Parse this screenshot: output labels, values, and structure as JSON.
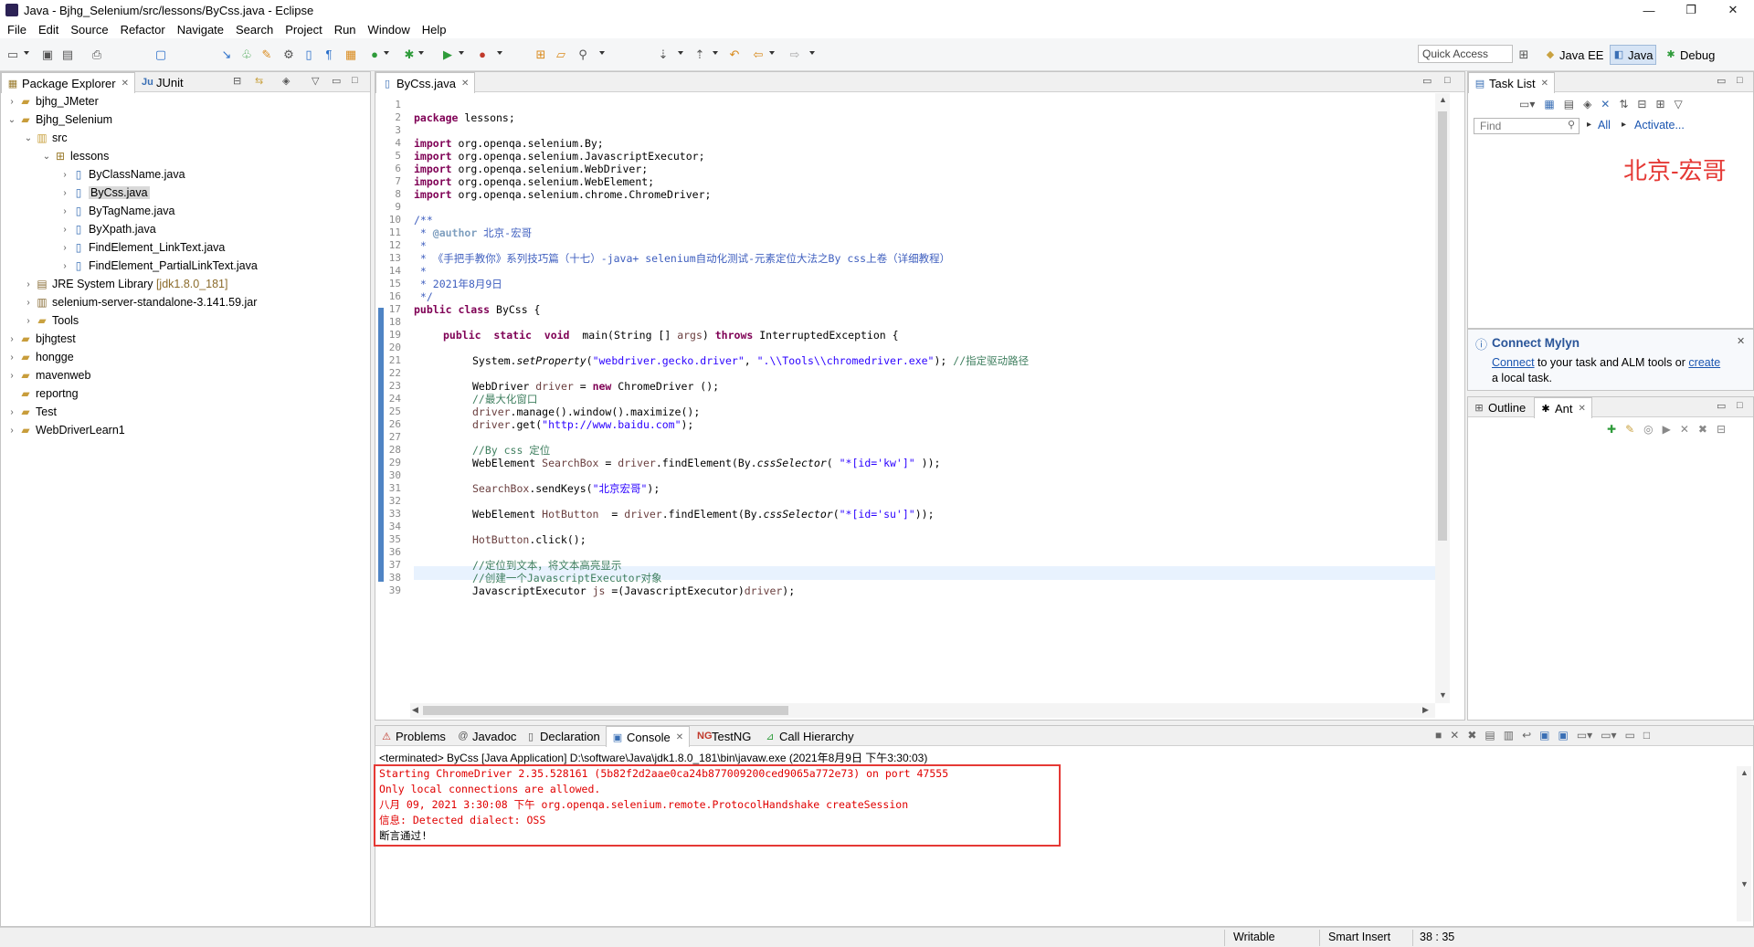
{
  "window": {
    "title": "Java - Bjhg_Selenium/src/lessons/ByCss.java - Eclipse",
    "minimize": "—",
    "maximize": "❐",
    "close": "✕"
  },
  "menu": [
    "File",
    "Edit",
    "Source",
    "Refactor",
    "Navigate",
    "Search",
    "Project",
    "Run",
    "Window",
    "Help"
  ],
  "toolbar": {
    "quick_access": "Quick Access",
    "perspectives": [
      {
        "label": "Java EE",
        "icon": "java-ee-icon"
      },
      {
        "label": "Java",
        "icon": "java-perspective-icon"
      },
      {
        "label": "Debug",
        "icon": "debug-bug-icon"
      }
    ]
  },
  "package_explorer": {
    "tabs": [
      "Package Explorer",
      "JUnit"
    ],
    "items": [
      {
        "label": "bjhg_JMeter",
        "suffix": ""
      },
      {
        "label": "Bjhg_Selenium",
        "suffix": ""
      },
      {
        "label": "src",
        "suffix": ""
      },
      {
        "label": "lessons",
        "suffix": ""
      },
      {
        "label": "ByClassName.java",
        "suffix": ""
      },
      {
        "label": "ByCss.java",
        "suffix": ""
      },
      {
        "label": "ByTagName.java",
        "suffix": ""
      },
      {
        "label": "ByXpath.java",
        "suffix": ""
      },
      {
        "label": "FindElement_LinkText.java",
        "suffix": ""
      },
      {
        "label": "FindElement_PartialLinkText.java",
        "suffix": ""
      },
      {
        "label": "JRE System Library",
        "suffix": "[jdk1.8.0_181]"
      },
      {
        "label": "selenium-server-standalone-3.141.59.jar",
        "suffix": ""
      },
      {
        "label": "Tools",
        "suffix": ""
      },
      {
        "label": "bjhgtest",
        "suffix": ""
      },
      {
        "label": "hongge",
        "suffix": ""
      },
      {
        "label": "mavenweb",
        "suffix": ""
      },
      {
        "label": "reportng",
        "suffix": ""
      },
      {
        "label": "Test",
        "suffix": ""
      },
      {
        "label": "WebDriverLearn1",
        "suffix": ""
      }
    ]
  },
  "editor": {
    "tab": "ByCss.java",
    "line_numbers": [
      "1",
      "2",
      "3",
      "4",
      "5",
      "6",
      "7",
      "8",
      "9",
      "10",
      "11",
      "12",
      "13",
      "14",
      "15",
      "16",
      "17",
      "18",
      "19",
      "20",
      "21",
      "22",
      "23",
      "24",
      "25",
      "26",
      "27",
      "28",
      "29",
      "30",
      "31",
      "32",
      "33",
      "34",
      "35",
      "36",
      "37",
      "38",
      "39"
    ],
    "code": {
      "l2_kw": "package",
      "l2_rest": " lessons;",
      "imp_kw": "import",
      "l4": " org.openqa.selenium.By;",
      "l5": " org.openqa.selenium.JavascriptExecutor;",
      "l6": " org.openqa.selenium.WebDriver;",
      "l7": " org.openqa.selenium.WebElement;",
      "l8": " org.openqa.selenium.chrome.ChromeDriver;",
      "l10": "/**",
      "l11_a": " * ",
      "l11_b": "@author",
      "l11_c": " 北京-宏哥",
      "l12": " *",
      "l13": " * 《手把手教你》系列技巧篇（十七）-java+ selenium自动化测试-元素定位大法之By css上卷（详细教程）",
      "l14": " *",
      "l15": " * 2021年8月9日",
      "l16": " */",
      "l17_kw": "public class",
      "l17_rest": " ByCss {",
      "l19_kw": "public  static  void",
      "l19_mid": "  main(String [] ",
      "l19_args": "args",
      "l19_c": ") ",
      "l19_kw2": "throws",
      "l19_end": " InterruptedException {",
      "l21_a": "System.",
      "l21_b": "setProperty",
      "l21_c": "(",
      "l21_s1": "\"webdriver.gecko.driver\"",
      "l21_d": ", ",
      "l21_s2": "\".\\\\Tools\\\\chromedriver.exe\"",
      "l21_e": "); ",
      "l21_cm": "//指定驱动路径",
      "l23_a": "WebDriver ",
      "l23_var": "driver",
      "l23_b": " = ",
      "l23_kw": "new",
      "l23_c": " ChromeDriver ();",
      "l24": "//最大化窗口",
      "l25_var": "driver",
      "l25_rest": ".manage().window().maximize();",
      "l26_var": "driver",
      "l26_a": ".get(",
      "l26_s": "\"http://www.baidu.com\"",
      "l26_b": ");",
      "l28": "//By css 定位",
      "l29_a": "WebElement ",
      "l29_var": "SearchBox",
      "l29_b": " = ",
      "l29_var2": "driver",
      "l29_c": ".findElement(By.",
      "l29_m": "cssSelector",
      "l29_d": "( ",
      "l29_s": "\"*[id='kw']\"",
      "l29_e": " ));",
      "l31_var": "SearchBox",
      "l31_a": ".sendKeys(",
      "l31_s": "\"北京宏哥\"",
      "l31_b": ");",
      "l33_a": "WebElement ",
      "l33_var": "HotButton",
      "l33_b": "  = ",
      "l33_var2": "driver",
      "l33_c": ".findElement(By.",
      "l33_m": "cssSelector",
      "l33_d": "(",
      "l33_s": "\"*[id='su']\"",
      "l33_e": "));",
      "l35_var": "HotButton",
      "l35_rest": ".click();",
      "l37": "//定位到文本，将文本高亮显示",
      "l38": "//创建一个JavascriptExecutor对象",
      "l39_a": "JavascriptExecutor ",
      "l39_var": "js",
      "l39_b": " =(JavascriptExecutor)",
      "l39_var2": "driver",
      "l39_c": ");"
    }
  },
  "task_list": {
    "tab": "Task List",
    "find_placeholder": "Find",
    "all": "All",
    "activate": "Activate...",
    "watermark": "北京-宏哥"
  },
  "mylyn": {
    "title": "Connect Mylyn",
    "connect": "Connect",
    "mid": " to your task and ALM tools or ",
    "create": "create",
    "end": "a local task."
  },
  "outline": {
    "tabs": [
      "Outline",
      "Ant"
    ]
  },
  "bottom_panel": {
    "tabs": [
      "Problems",
      "Javadoc",
      "Declaration",
      "Console",
      "TestNG",
      "Call Hierarchy"
    ],
    "header": "<terminated> ByCss [Java Application] D:\\software\\Java\\jdk1.8.0_181\\bin\\javaw.exe (2021年8月9日 下午3:30:03)",
    "console": [
      "Starting ChromeDriver 2.35.528161 (5b82f2d2aae0ca24b877009200ced9065a772e73) on port 47555",
      "Only local connections are allowed.",
      "八月 09, 2021 3:30:08 下午 org.openqa.selenium.remote.ProtocolHandshake createSession",
      "信息: Detected dialect: OSS",
      "断言通过!"
    ]
  },
  "status": {
    "writable": "Writable",
    "insert": "Smart Insert",
    "position": "38 : 35"
  },
  "colors": {
    "highlight_box": "#e53935",
    "keyword": "#7f0055",
    "string": "#2a00ff",
    "comment": "#3f7f5f",
    "error_text": "#e00000"
  }
}
